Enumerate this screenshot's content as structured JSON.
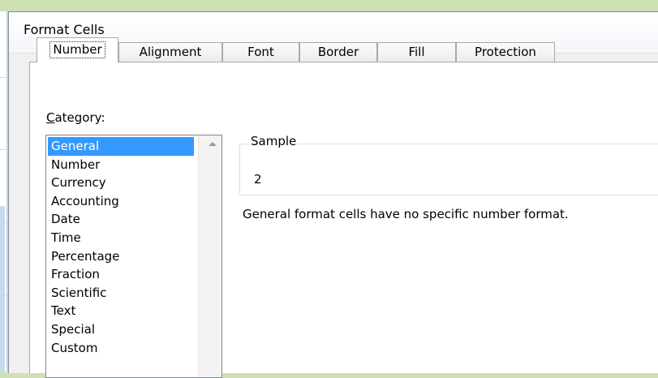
{
  "window": {
    "title": "Format Cells"
  },
  "tabs": [
    {
      "label": "Number",
      "active": true
    },
    {
      "label": "Alignment"
    },
    {
      "label": "Font"
    },
    {
      "label": "Border"
    },
    {
      "label": "Fill"
    },
    {
      "label": "Protection"
    }
  ],
  "category": {
    "label_first": "C",
    "label_rest": "ategory:",
    "selected": "General",
    "items": [
      "General",
      "Number",
      "Currency",
      "Accounting",
      "Date",
      "Time",
      "Percentage",
      "Fraction",
      "Scientific",
      "Text",
      "Special",
      "Custom"
    ]
  },
  "sample": {
    "legend": "Sample",
    "value": "2"
  },
  "description": "General format cells have no specific number format.",
  "colors": {
    "selection": "#3399ff",
    "desktop": "#cfe0b4"
  }
}
